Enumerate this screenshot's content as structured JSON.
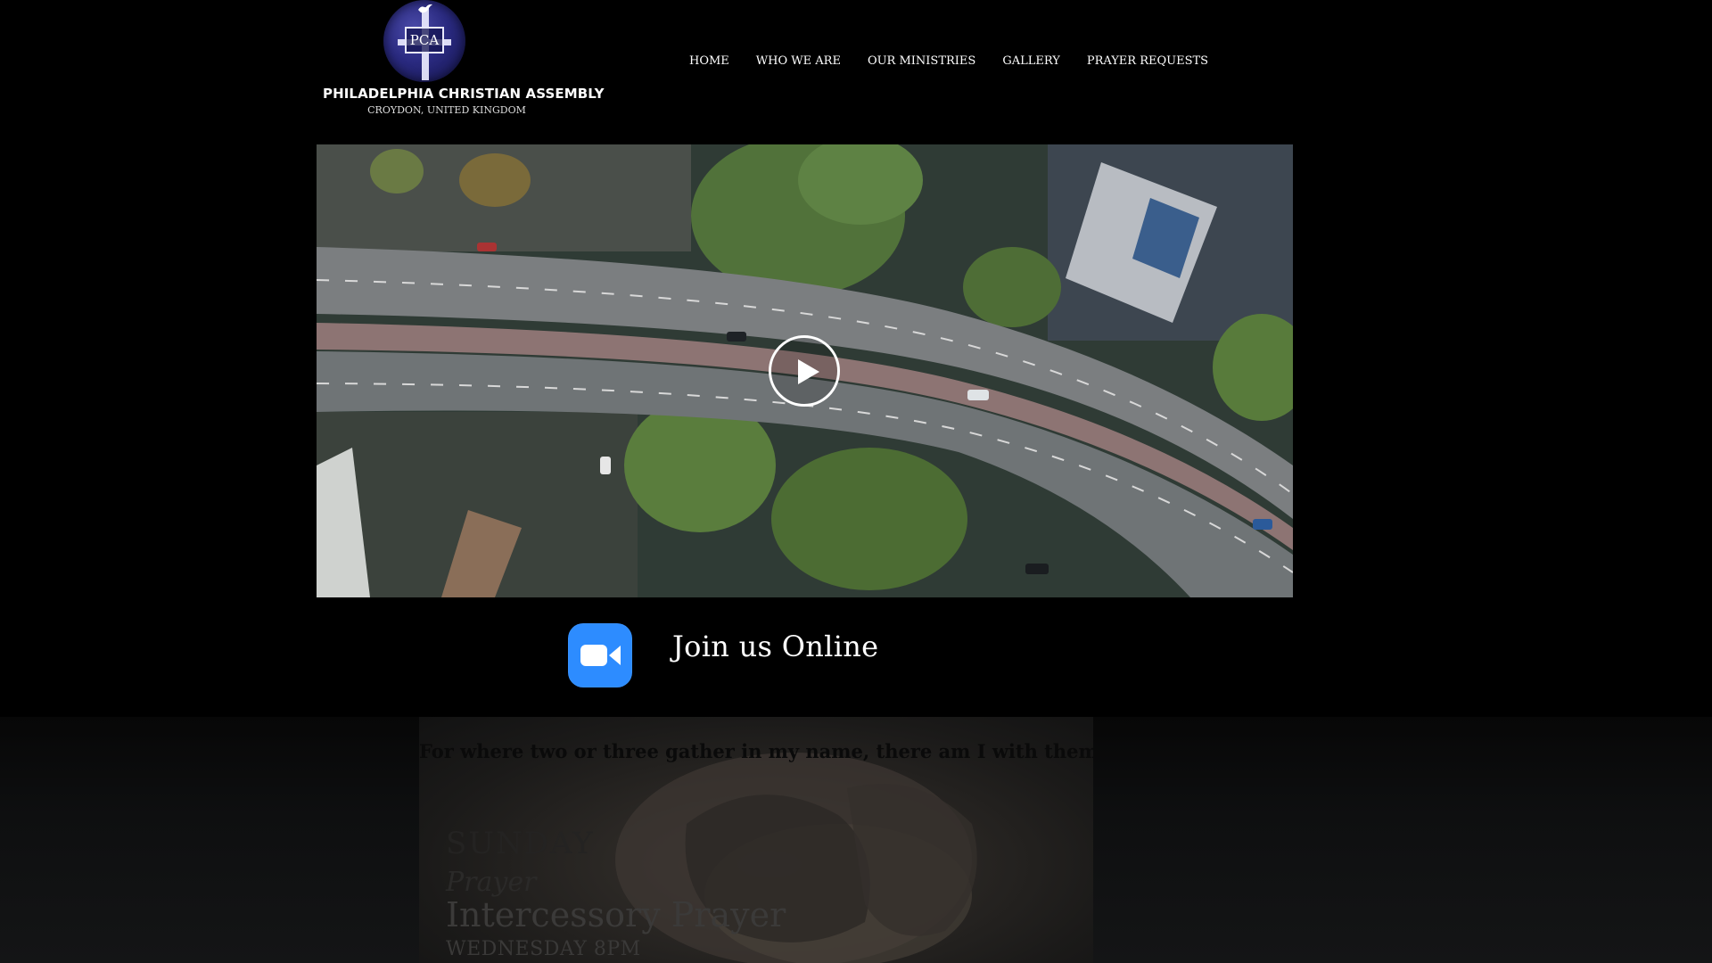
{
  "header": {
    "logo": {
      "emblem_text": "PCA",
      "title": "PHILADELPHIA CHRISTIAN ASSEMBLY",
      "subtitle": "CROYDON, UNITED KINGDOM"
    },
    "nav": [
      {
        "label": "HOME"
      },
      {
        "label": "WHO WE ARE"
      },
      {
        "label": "OUR MINISTRIES"
      },
      {
        "label": "GALLERY"
      },
      {
        "label": "PRAYER REQUESTS"
      }
    ]
  },
  "video": {
    "play_icon": "play-icon"
  },
  "online": {
    "icon": "video-camera-icon",
    "icon_color": "#2d8cff",
    "label": "Join us Online"
  },
  "prayer": {
    "verse": "For where two or three gather in my name, there am I with them",
    "sunday": "SUNDAY",
    "script": "Prayer",
    "title": "Intercessory Prayer",
    "schedule": "WEDNESDAY 8PM"
  }
}
